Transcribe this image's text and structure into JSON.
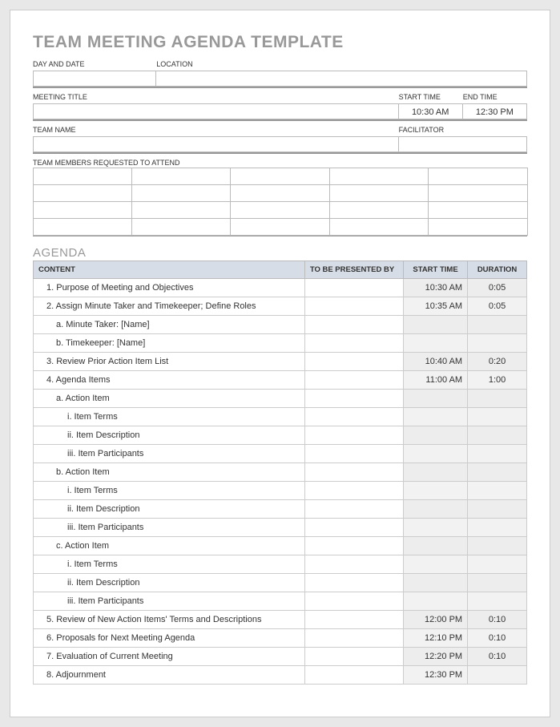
{
  "title": "TEAM MEETING AGENDA TEMPLATE",
  "labels": {
    "day_and_date": "DAY AND DATE",
    "location": "LOCATION",
    "meeting_title": "MEETING TITLE",
    "start_time": "START TIME",
    "end_time": "END TIME",
    "team_name": "TEAM NAME",
    "facilitator": "FACILITATOR",
    "team_members": "TEAM MEMBERS REQUESTED TO ATTEND"
  },
  "header": {
    "day_and_date": "",
    "location": "",
    "meeting_title": "",
    "start_time": "10:30 AM",
    "end_time": "12:30 PM",
    "team_name": "",
    "facilitator": ""
  },
  "agenda_heading": "AGENDA",
  "agenda_columns": {
    "content": "CONTENT",
    "presenter": "TO BE PRESENTED BY",
    "start": "START TIME",
    "duration": "DURATION"
  },
  "agenda": [
    {
      "content": "1. Purpose of Meeting and Objectives",
      "indent": 1,
      "presenter": "",
      "start": "10:30 AM",
      "duration": "0:05"
    },
    {
      "content": "2. Assign Minute Taker and Timekeeper; Define Roles",
      "indent": 1,
      "presenter": "",
      "start": "10:35 AM",
      "duration": "0:05"
    },
    {
      "content": "a. Minute Taker: [Name]",
      "indent": 2,
      "presenter": "",
      "start": "",
      "duration": ""
    },
    {
      "content": "b. Timekeeper: [Name]",
      "indent": 2,
      "presenter": "",
      "start": "",
      "duration": ""
    },
    {
      "content": "3. Review Prior Action Item List",
      "indent": 1,
      "presenter": "",
      "start": "10:40 AM",
      "duration": "0:20"
    },
    {
      "content": "4. Agenda Items",
      "indent": 1,
      "presenter": "",
      "start": "11:00 AM",
      "duration": "1:00"
    },
    {
      "content": "a. Action Item",
      "indent": 2,
      "presenter": "",
      "start": "",
      "duration": ""
    },
    {
      "content": "i. Item Terms",
      "indent": 3,
      "presenter": "",
      "start": "",
      "duration": ""
    },
    {
      "content": "ii. Item Description",
      "indent": 3,
      "presenter": "",
      "start": "",
      "duration": ""
    },
    {
      "content": "iii. Item Participants",
      "indent": 3,
      "presenter": "",
      "start": "",
      "duration": ""
    },
    {
      "content": "b. Action Item",
      "indent": 2,
      "presenter": "",
      "start": "",
      "duration": ""
    },
    {
      "content": "i. Item Terms",
      "indent": 3,
      "presenter": "",
      "start": "",
      "duration": ""
    },
    {
      "content": "ii. Item Description",
      "indent": 3,
      "presenter": "",
      "start": "",
      "duration": ""
    },
    {
      "content": "iii. Item Participants",
      "indent": 3,
      "presenter": "",
      "start": "",
      "duration": ""
    },
    {
      "content": "c. Action Item",
      "indent": 2,
      "presenter": "",
      "start": "",
      "duration": ""
    },
    {
      "content": "i. Item Terms",
      "indent": 3,
      "presenter": "",
      "start": "",
      "duration": ""
    },
    {
      "content": "ii. Item Description",
      "indent": 3,
      "presenter": "",
      "start": "",
      "duration": ""
    },
    {
      "content": "iii. Item Participants",
      "indent": 3,
      "presenter": "",
      "start": "",
      "duration": ""
    },
    {
      "content": "5. Review of New Action Items' Terms and Descriptions",
      "indent": 1,
      "presenter": "",
      "start": "12:00 PM",
      "duration": "0:10"
    },
    {
      "content": "6. Proposals for Next Meeting Agenda",
      "indent": 1,
      "presenter": "",
      "start": "12:10 PM",
      "duration": "0:10"
    },
    {
      "content": "7. Evaluation of Current Meeting",
      "indent": 1,
      "presenter": "",
      "start": "12:20 PM",
      "duration": "0:10"
    },
    {
      "content": "8. Adjournment",
      "indent": 1,
      "presenter": "",
      "start": "12:30 PM",
      "duration": ""
    }
  ]
}
